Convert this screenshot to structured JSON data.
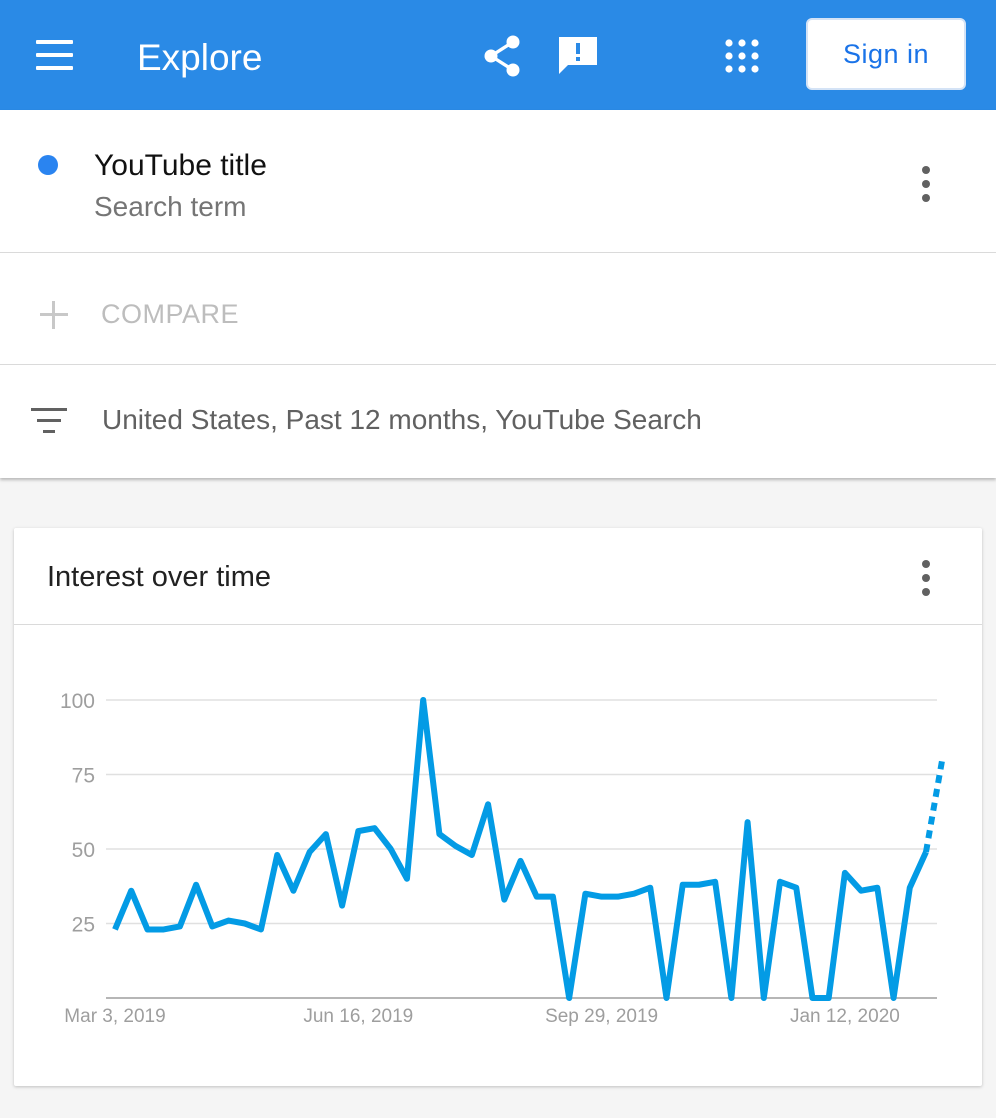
{
  "header": {
    "menu_icon": "hamburger-menu-icon",
    "title": "Explore",
    "share_icon": "share-icon",
    "feedback_icon": "feedback-icon",
    "apps_icon": "apps-grid-icon",
    "sign_in_label": "Sign in",
    "background_color": "#2a8ae6"
  },
  "search_term": {
    "title": "YouTube title",
    "subtitle": "Search term",
    "dot_color": "#2a84f0",
    "menu_icon": "more-vert-icon"
  },
  "compare": {
    "icon": "plus-icon",
    "label": "COMPARE"
  },
  "filters": {
    "icon": "filter-list-icon",
    "text": "United States, Past 12 months, YouTube Search"
  },
  "interest_card": {
    "title": "Interest over time",
    "menu_icon": "more-vert-icon"
  },
  "chart_data": {
    "type": "line",
    "title": "",
    "xlabel": "",
    "ylabel": "",
    "ylim": [
      0,
      100
    ],
    "y_ticks": [
      25,
      50,
      75,
      100
    ],
    "x_tick_labels": [
      "Mar 3, 2019",
      "Jun 16, 2019",
      "Sep 29, 2019",
      "Jan 12, 2020"
    ],
    "x_tick_index": [
      0,
      15,
      30,
      45
    ],
    "grid": true,
    "line_color": "#039be5",
    "partial_from_index": 50,
    "series": [
      {
        "values": [
          23,
          36,
          23,
          23,
          24,
          38,
          24,
          26,
          25,
          23,
          48,
          36,
          49,
          55,
          31,
          56,
          57,
          50,
          40,
          100,
          55,
          51,
          48,
          65,
          33,
          46,
          34,
          34,
          0,
          35,
          34,
          34,
          35,
          37,
          0,
          38,
          38,
          39,
          0,
          59,
          0,
          39,
          37,
          0,
          0,
          42,
          36,
          37,
          0,
          37,
          49,
          80
        ]
      }
    ]
  }
}
